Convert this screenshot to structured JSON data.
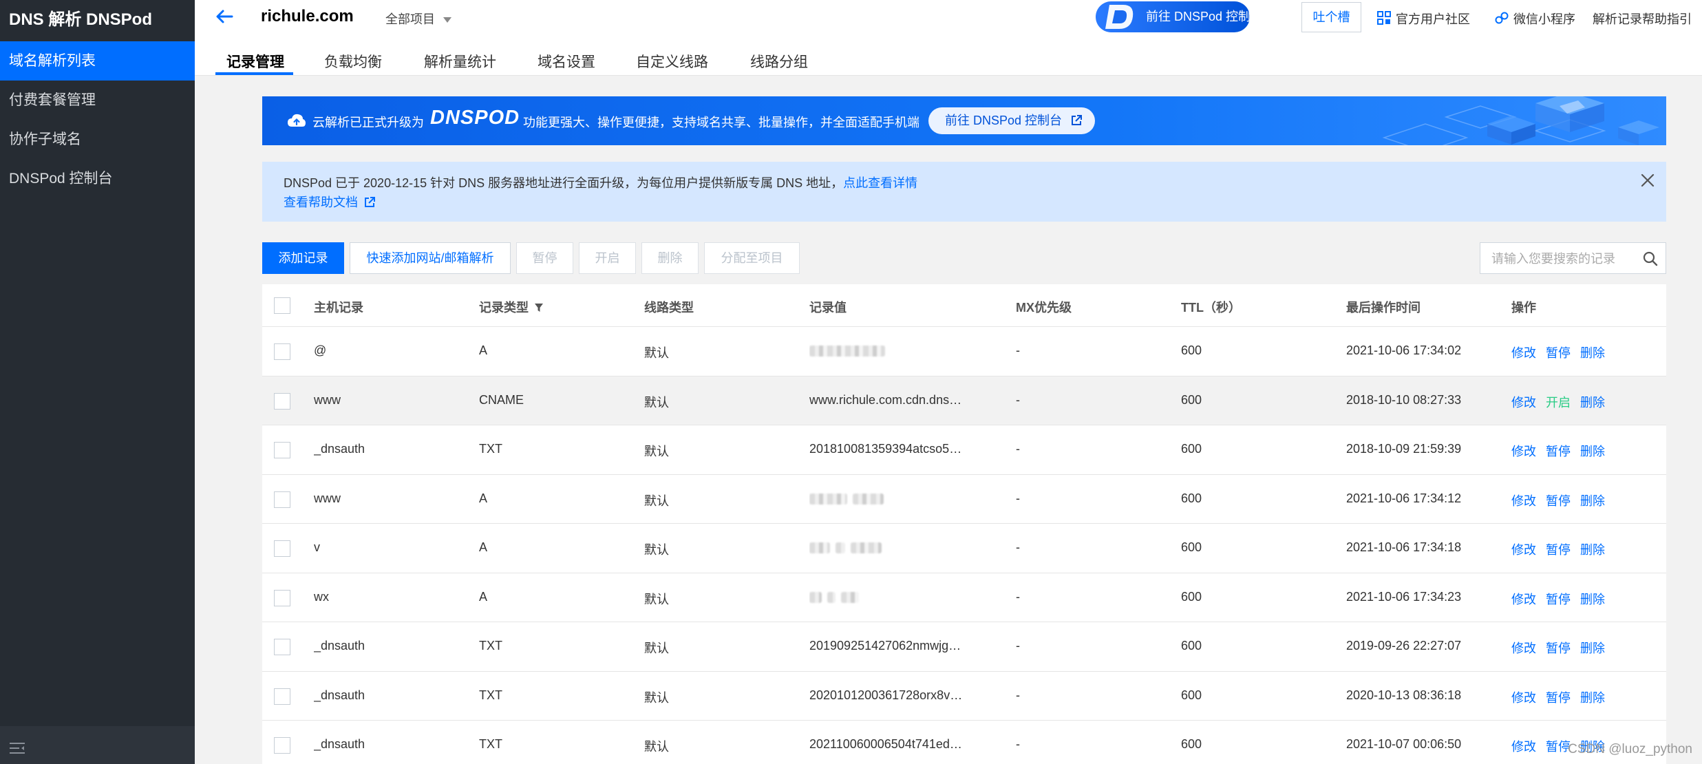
{
  "sidebar": {
    "brand": "DNS 解析 DNSPod",
    "items": [
      "域名解析列表",
      "付费套餐管理",
      "协作子域名",
      "DNSPod 控制台"
    ]
  },
  "header": {
    "domain": "richule.com",
    "project_select": "全部项目",
    "dnspod_button": "前往 DNSPod 控制台",
    "tucao_button": "吐个槽",
    "community_link": "官方用户社区",
    "miniprogram_link": "微信小程序",
    "help_link": "解析记录帮助指引",
    "tabs": [
      "记录管理",
      "负载均衡",
      "解析量统计",
      "域名设置",
      "自定义线路",
      "线路分组"
    ]
  },
  "banner": {
    "text1": "云解析已正式升级为",
    "wordmark": "DNSPOD",
    "text2": "功能更强大、操作更便捷，支持域名共享、批量操作，并全面适配手机端",
    "button": "前往 DNSPod 控制台"
  },
  "notice": {
    "text": "DNSPod 已于 2020-12-15 针对 DNS 服务器地址进行全面升级，为每位用户提供新版专属 DNS 地址，",
    "details_link": "点此查看详情",
    "help_link": "查看帮助文档"
  },
  "toolbar": {
    "add": "添加记录",
    "quick_add": "快速添加网站/邮箱解析",
    "pause": "暂停",
    "enable": "开启",
    "delete": "删除",
    "assign": "分配至项目",
    "search_placeholder": "请输入您要搜索的记录"
  },
  "table": {
    "columns": [
      "主机记录",
      "记录类型",
      "线路类型",
      "记录值",
      "MX优先级",
      "TTL（秒）",
      "最后操作时间",
      "操作"
    ],
    "rows": [
      {
        "host": "@",
        "type": "A",
        "line": "默认",
        "value": "",
        "mx": "-",
        "ttl": "600",
        "time": "2021-10-06 17:34:02",
        "op1": "修改",
        "op2": "暂停",
        "op3": "删除"
      },
      {
        "host": "www",
        "type": "CNAME",
        "line": "默认",
        "value": "www.richule.com.cdn.dns…",
        "mx": "-",
        "ttl": "600",
        "time": "2018-10-10 08:27:33",
        "op1": "修改",
        "op2": "开启",
        "op3": "删除"
      },
      {
        "host": "_dnsauth",
        "type": "TXT",
        "line": "默认",
        "value": "201810081359394atcso5…",
        "mx": "-",
        "ttl": "600",
        "time": "2018-10-09 21:59:39",
        "op1": "修改",
        "op2": "暂停",
        "op3": "删除"
      },
      {
        "host": "www",
        "type": "A",
        "line": "默认",
        "value": "",
        "mx": "-",
        "ttl": "600",
        "time": "2021-10-06 17:34:12",
        "op1": "修改",
        "op2": "暂停",
        "op3": "删除"
      },
      {
        "host": "v",
        "type": "A",
        "line": "默认",
        "value": "",
        "mx": "-",
        "ttl": "600",
        "time": "2021-10-06 17:34:18",
        "op1": "修改",
        "op2": "暂停",
        "op3": "删除"
      },
      {
        "host": "wx",
        "type": "A",
        "line": "默认",
        "value": "",
        "mx": "-",
        "ttl": "600",
        "time": "2021-10-06 17:34:23",
        "op1": "修改",
        "op2": "暂停",
        "op3": "删除"
      },
      {
        "host": "_dnsauth",
        "type": "TXT",
        "line": "默认",
        "value": "201909251427062nmwjg…",
        "mx": "-",
        "ttl": "600",
        "time": "2019-09-26 22:27:07",
        "op1": "修改",
        "op2": "暂停",
        "op3": "删除"
      },
      {
        "host": "_dnsauth",
        "type": "TXT",
        "line": "默认",
        "value": "2020101200361728orx8v…",
        "mx": "-",
        "ttl": "600",
        "time": "2020-10-13 08:36:18",
        "op1": "修改",
        "op2": "暂停",
        "op3": "删除"
      },
      {
        "host": "_dnsauth",
        "type": "TXT",
        "line": "默认",
        "value": "202110060006504t741ed…",
        "mx": "-",
        "ttl": "600",
        "time": "2021-10-07 00:06:50",
        "op1": "修改",
        "op2": "暂停",
        "op3": "删除"
      }
    ]
  },
  "watermark": "CSDN @luoz_python",
  "colors": {
    "accent": "#006eff",
    "sidebar": "#262c33",
    "notice_bg": "#d5e7ff",
    "enable_green": "#29cc85"
  }
}
